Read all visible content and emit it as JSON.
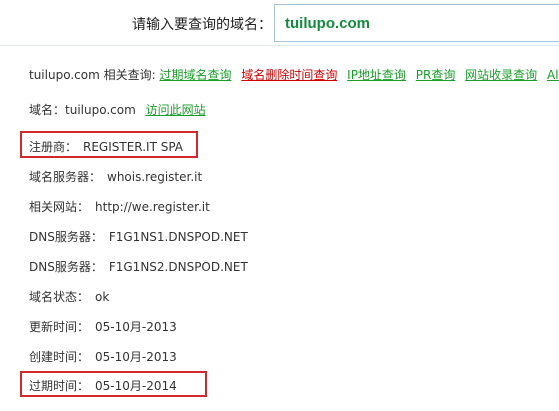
{
  "search": {
    "label": "请输入要查询的域名：",
    "value": "tuilupo.com"
  },
  "related": {
    "prefix": "tuilupo.com 相关查询:",
    "links": [
      {
        "label": "过期域名查询",
        "color": "#1a9e2a"
      },
      {
        "label": "域名删除时间查询",
        "color": "#cc0000"
      },
      {
        "label": "IP地址查询",
        "color": "#1a9e2a"
      },
      {
        "label": "PR查询",
        "color": "#1a9e2a"
      },
      {
        "label": "网站收录查询",
        "color": "#1a9e2a"
      },
      {
        "label": "Alexa",
        "color": "#1a9e2a"
      }
    ]
  },
  "domain": {
    "label": "域名：",
    "value": "tuilupo.com",
    "visit_link": "访问此网站"
  },
  "info": [
    {
      "label": "注册商：",
      "value": "REGISTER.IT SPA",
      "highlight": true
    },
    {
      "label": "域名服务器：",
      "value": "whois.register.it",
      "highlight": false
    },
    {
      "label": "相关网站：",
      "value": "http://we.register.it",
      "highlight": false
    },
    {
      "label": "DNS服务器：",
      "value": "F1G1NS1.DNSPOD.NET",
      "highlight": false
    },
    {
      "label": "DNS服务器：",
      "value": "F1G1NS2.DNSPOD.NET",
      "highlight": false
    },
    {
      "label": "域名状态：",
      "value": "ok",
      "highlight": false
    },
    {
      "label": "更新时间：",
      "value": "05-10月-2013",
      "highlight": false
    },
    {
      "label": "创建时间：",
      "value": "05-10月-2013",
      "highlight": false
    },
    {
      "label": "过期时间：",
      "value": "05-10月-2014",
      "highlight": true
    }
  ],
  "colors": {
    "link_green": "#1a9e2a",
    "link_red": "#cc0000",
    "highlight_border": "#d0282c",
    "input_text": "#138a3c"
  }
}
